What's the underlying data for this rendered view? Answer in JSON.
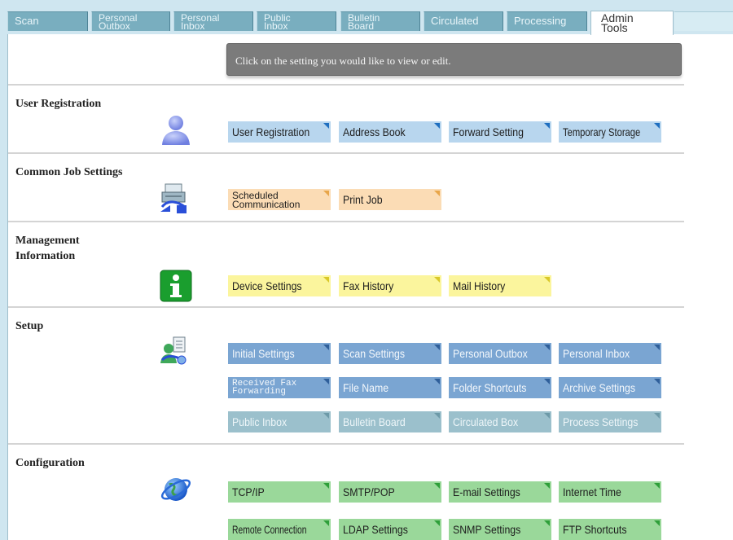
{
  "tabs": [
    {
      "label": "Scan",
      "active": false
    },
    {
      "label": "Personal Outbox",
      "active": false
    },
    {
      "label": "Personal Inbox",
      "active": false
    },
    {
      "label": "Public Inbox",
      "active": false
    },
    {
      "label": "Bulletin Board",
      "active": false
    },
    {
      "label": "Circulated",
      "active": false
    },
    {
      "label": "Processing",
      "active": false
    },
    {
      "label": "Admin Tools",
      "active": true
    }
  ],
  "tab_lines": {
    "outbox": [
      "Personal",
      "Outbox"
    ],
    "inbox": [
      "Personal",
      "Inbox"
    ],
    "public": [
      "Public",
      "Inbox"
    ],
    "bulletin": [
      "Bulletin",
      "Board"
    ],
    "admin": [
      "Admin",
      "Tools"
    ]
  },
  "hint": "Click on the setting you would like to view or edit.",
  "sections": {
    "user_registration": {
      "title": "User Registration",
      "icon": "user-icon",
      "buttons": [
        "User Registration",
        "Address Book",
        "Forward Setting",
        "Temporary Storage"
      ]
    },
    "common_job": {
      "title": "Common Job Settings",
      "icon": "printer-fax-icon",
      "buttons": [
        "Scheduled Communication",
        "Print Job"
      ],
      "scheduled_lines": [
        "Scheduled",
        "Communication"
      ]
    },
    "management": {
      "title_lines": [
        "Management",
        "Information"
      ],
      "icon": "info-icon",
      "buttons": [
        "Device Settings",
        "Fax History",
        "Mail History"
      ]
    },
    "setup": {
      "title": "Setup",
      "icon": "user-document-icon",
      "buttons": [
        "Initial Settings",
        "Scan Settings",
        "Personal Outbox",
        "Personal Inbox",
        "Received Fax Forwarding",
        "File Name",
        "Folder Shortcuts",
        "Archive Settings",
        "Public Inbox",
        "Bulletin Board",
        "Circulated Box",
        "Process Settings"
      ],
      "received_lines": [
        "Received Fax",
        "Forwarding"
      ]
    },
    "configuration": {
      "title": "Configuration",
      "icon": "globe-icon",
      "buttons": [
        "TCP/IP",
        "SMTP/POP",
        "E-mail Settings",
        "Internet Time",
        "Remote Connection",
        "LDAP Settings",
        "SNMP Settings",
        "FTP Shortcuts"
      ]
    }
  },
  "colors": {
    "user_buttons": "#b8d6ee",
    "job_buttons": "#fbdcb5",
    "management_buttons": "#fbf59d",
    "setup_buttons": "#7aa5d2",
    "configuration_buttons": "#9ad89a",
    "tab": "#79aebf",
    "hint_box": "#7b7b7b"
  }
}
